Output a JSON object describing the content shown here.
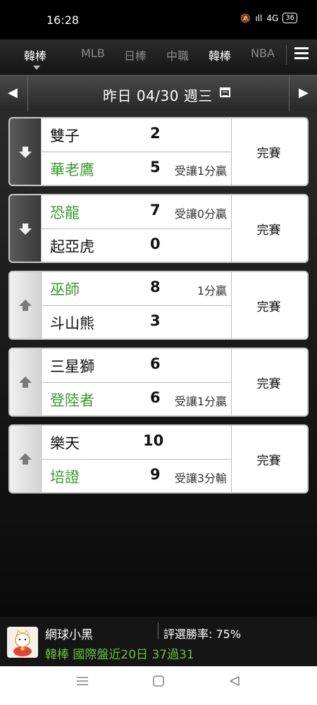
{
  "status_bar": {
    "time": "16:28",
    "battery": "36",
    "network": "4G"
  },
  "tabs": [
    {
      "label": "韓棒",
      "active": true
    },
    {
      "label": "MLB",
      "active": false
    },
    {
      "label": "日棒",
      "active": false
    },
    {
      "label": "中職",
      "active": false
    },
    {
      "label": "韓棒",
      "active": true
    },
    {
      "label": "NBA",
      "active": false
    }
  ],
  "date_bar": {
    "prev": "◀",
    "next": "▶",
    "date_label": "昨日 04/30 週三"
  },
  "games": [
    {
      "row1": {
        "team": "雙子",
        "score": "2",
        "note": "",
        "highlight": false
      },
      "row2": {
        "team": "華老鷹",
        "score": "5",
        "note": "受讓1分贏",
        "highlight": true
      },
      "status": "完賽",
      "trend": "down"
    },
    {
      "row1": {
        "team": "恐龍",
        "score": "7",
        "note": "受讓0分贏",
        "highlight": true
      },
      "row2": {
        "team": "起亞虎",
        "score": "0",
        "note": "",
        "highlight": false
      },
      "status": "完賽",
      "trend": "down"
    },
    {
      "row1": {
        "team": "巫師",
        "score": "8",
        "note": "1分贏",
        "highlight": true
      },
      "row2": {
        "team": "斗山熊",
        "score": "3",
        "note": "",
        "highlight": false
      },
      "status": "完賽",
      "trend": "up"
    },
    {
      "row1": {
        "team": "三星獅",
        "score": "6",
        "note": "",
        "highlight": false
      },
      "row2": {
        "team": "登陸者",
        "score": "6",
        "note": "受讓1分贏",
        "highlight": true
      },
      "status": "完賽",
      "trend": "up"
    },
    {
      "row1": {
        "team": "樂天",
        "score": "10",
        "note": "",
        "highlight": false
      },
      "row2": {
        "team": "培證",
        "score": "9",
        "note": "受讓3分輸",
        "highlight": true
      },
      "status": "完賽",
      "trend": "up"
    }
  ],
  "banner": {
    "name": "網球小黑",
    "rate": "評選勝率: 75%",
    "line": "韓棒 國際盤近20日 37過31"
  },
  "colors": {
    "green": "#3a9a2e",
    "banner_green": "#63c23a"
  }
}
